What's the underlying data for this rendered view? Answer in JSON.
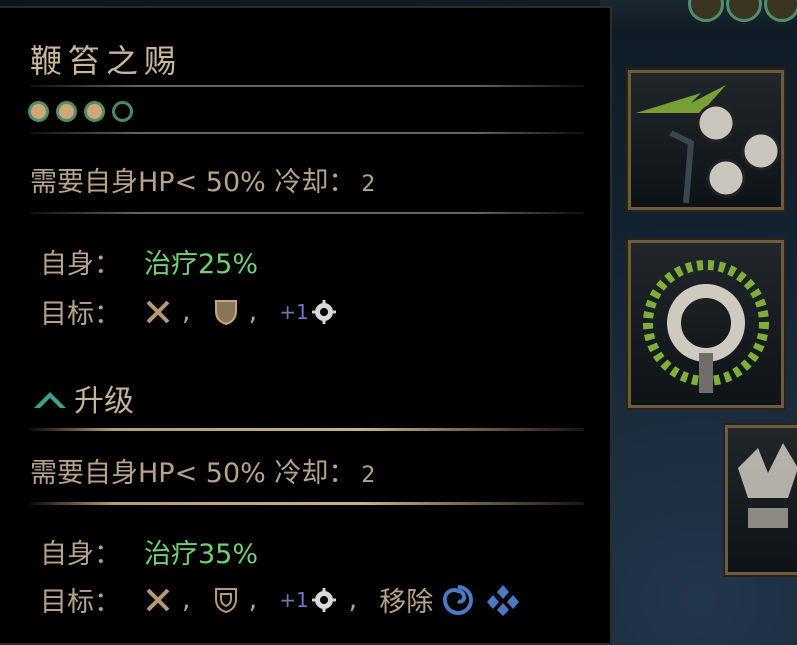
{
  "skill": {
    "title": "鞭笞之赐",
    "pips": [
      true,
      true,
      true,
      false
    ]
  },
  "base": {
    "requirement": "需要自身HP< 50%",
    "cooldown_label": "冷却：",
    "cooldown_value": "2",
    "self_label": "自身：",
    "self_effect": "治疗25%",
    "target_label": "目标：",
    "target_icons": [
      "crossed-swords-icon",
      "shield-icon"
    ],
    "target_stat_plus": "+1",
    "target_stat_icon": "speed-cog-icon"
  },
  "upgrade": {
    "label": "升级",
    "requirement": "需要自身HP< 50%",
    "cooldown_label": "冷却：",
    "cooldown_value": "2",
    "self_label": "自身：",
    "self_effect": "治疗35%",
    "target_label": "目标：",
    "target_icons": [
      "crossed-swords-icon",
      "shield-icon"
    ],
    "target_stat_plus": "+1",
    "target_stat_icon": "speed-cog-icon",
    "remove_label": "移除",
    "remove_icons": [
      "spiral-icon",
      "diamond-cluster-icon"
    ]
  },
  "colors": {
    "heal": "#6fd074",
    "text": "#b6a48a",
    "pip_fill": "#d1a777",
    "pip_ring": "#4f8e6d",
    "stat_plus": "#6b78c7"
  },
  "side_icons": [
    "flail-skill-icon",
    "thorn-ring-skill-icon",
    "crown-skill-icon"
  ]
}
